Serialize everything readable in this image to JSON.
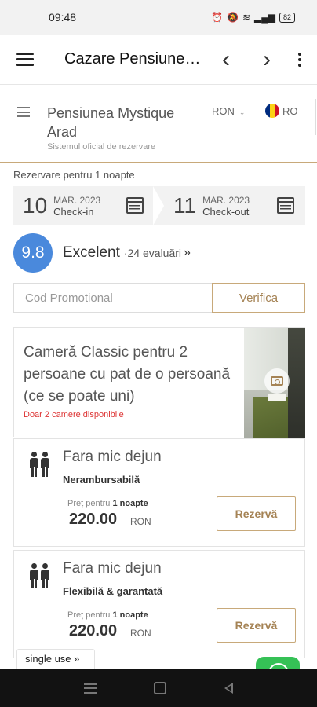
{
  "status_bar": {
    "time": "09:48",
    "battery": "82"
  },
  "app_bar": {
    "title": "Cazare Pensiunea Mystique Arad"
  },
  "site": {
    "name": "Pensiunea Mystique Arad",
    "subtitle": "Sistemul oficial de rezervare",
    "currency": "RON",
    "language": "RO",
    "flag_colors": [
      "#002b7f",
      "#fcd116",
      "#ce1126"
    ]
  },
  "booking": {
    "stay_label": "Rezervare pentru 1 noapte",
    "checkin": {
      "day": "10",
      "month_year": "MAR. 2023",
      "label": "Check-in"
    },
    "checkout": {
      "day": "11",
      "month_year": "MAR. 2023",
      "label": "Check-out"
    }
  },
  "rating": {
    "score": "9.8",
    "word": "Excelent",
    "count": "·24 evaluări",
    "chevron": "»"
  },
  "promo": {
    "placeholder": "Cod Promotional",
    "button": "Verifica"
  },
  "room": {
    "title": "Cameră Classic pentru 2 persoane cu pat de o persoană (ce se poate uni)",
    "availability": "Doar 2 camere disponibile"
  },
  "rates": [
    {
      "name": "Fara mic dejun",
      "policy": "Nerambursabilă",
      "price_label_prefix": "Preț pentru",
      "price_label_nights": "1 noapte",
      "price": "220.00",
      "currency": "RON",
      "button": "Rezervă"
    },
    {
      "name": "Fara mic dejun",
      "policy": "Flexibilă & garantată",
      "price_label_prefix": "Preț pentru",
      "price_label_nights": "1 noapte",
      "price": "220.00",
      "currency": "RON",
      "button": "Rezervă"
    }
  ],
  "single_use": {
    "label": "single use »"
  },
  "colors": {
    "accent": "#c8a97a",
    "rating_badge": "#4a89dc",
    "chat": "#35c156",
    "alert": "#dd3333"
  }
}
